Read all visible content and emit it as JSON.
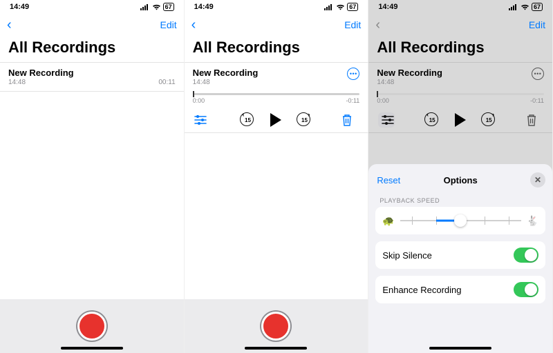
{
  "status": {
    "time": "14:49",
    "battery": "67"
  },
  "nav": {
    "edit": "Edit"
  },
  "title": "All Recordings",
  "recording": {
    "name": "New Recording",
    "time": "14:48",
    "duration": "00:11"
  },
  "scrub": {
    "start": "0:00",
    "end": "-0:11"
  },
  "skip": {
    "back": "15",
    "fwd": "15"
  },
  "sheet": {
    "reset": "Reset",
    "title": "Options",
    "section_speed": "PLAYBACK SPEED",
    "skip_silence": "Skip Silence",
    "enhance": "Enhance Recording",
    "skip_silence_on": true,
    "enhance_on": true
  }
}
